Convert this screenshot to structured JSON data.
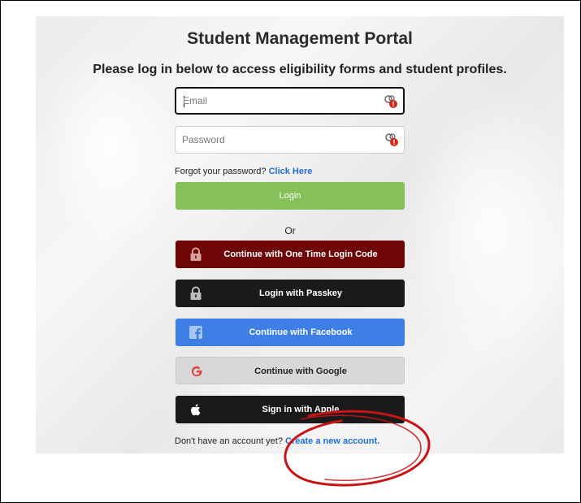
{
  "header": {
    "title": "Student Management Portal",
    "subtitle": "Please log in below to access eligibility forms and student profiles."
  },
  "form": {
    "email_placeholder": "Email",
    "password_placeholder": "Password",
    "forgot_text": "Forgot your password?",
    "forgot_link": "Click Here",
    "login_label": "Login",
    "or_label": "Or"
  },
  "sso": {
    "one_time_code": "Continue with One Time Login Code",
    "passkey": "Login with Passkey",
    "facebook": "Continue with Facebook",
    "google": "Continue with Google",
    "apple": "Sign in with Apple"
  },
  "signup": {
    "prompt": "Don't have an account yet?",
    "link": "Create a new account."
  },
  "colors": {
    "login": "#86c058",
    "one_time_code": "#6e0606",
    "passkey": "#1a1a1a",
    "facebook": "#3e7fe6",
    "google": "#d8d8d8",
    "apple": "#1a1a1a",
    "link": "#1f6fd1",
    "annotation": "#c81414"
  },
  "icons": {
    "email_field": "password-manager-key-icon",
    "password_field": "password-manager-key-icon",
    "one_time_code": "padlock-icon",
    "passkey": "padlock-icon",
    "facebook": "facebook-logo-icon",
    "google": "google-logo-icon",
    "apple": "apple-logo-icon"
  }
}
